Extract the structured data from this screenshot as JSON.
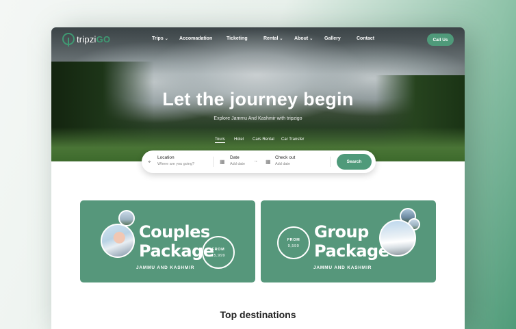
{
  "brand": {
    "logo_text": "tripzi",
    "logo_accent": "GO"
  },
  "nav": {
    "items": [
      {
        "label": "Trips",
        "dropdown": true
      },
      {
        "label": "Accomadation",
        "dropdown": false
      },
      {
        "label": "Ticketing",
        "dropdown": false
      },
      {
        "label": "Rental",
        "dropdown": true
      },
      {
        "label": "About",
        "dropdown": true
      },
      {
        "label": "Gallery",
        "dropdown": false
      },
      {
        "label": "Contact",
        "dropdown": false
      }
    ],
    "chevron": "⌄",
    "call_label": "Call Us"
  },
  "hero": {
    "title": "Let the journey begin",
    "subtitle": "Explore Jammu And Kashmir with tripzigo",
    "tabs": [
      "Tours",
      "Hotel",
      "Cars Rental",
      "Car Transfer"
    ],
    "active_tab": "Tours"
  },
  "search": {
    "location_label": "Location",
    "location_placeholder": "Where are you going?",
    "date_label": "Date",
    "date_placeholder": "Add date",
    "checkout_label": "Check out",
    "checkout_placeholder": "Add date",
    "arrow": "→",
    "button_label": "Search"
  },
  "cards": [
    {
      "title_line1": "Couples",
      "title_line2": "Package",
      "subtitle": "JAMMU AND KASHMIR",
      "from_label": "FROM",
      "price": "15,999"
    },
    {
      "title_line1": "Group",
      "title_line2": "Package",
      "subtitle": "JAMMU AND KASHMIR",
      "from_label": "FROM",
      "price": "9,599"
    }
  ],
  "section": {
    "title": "Top destinations"
  },
  "colors": {
    "accent": "#4f9a7a",
    "card": "#56977b"
  }
}
